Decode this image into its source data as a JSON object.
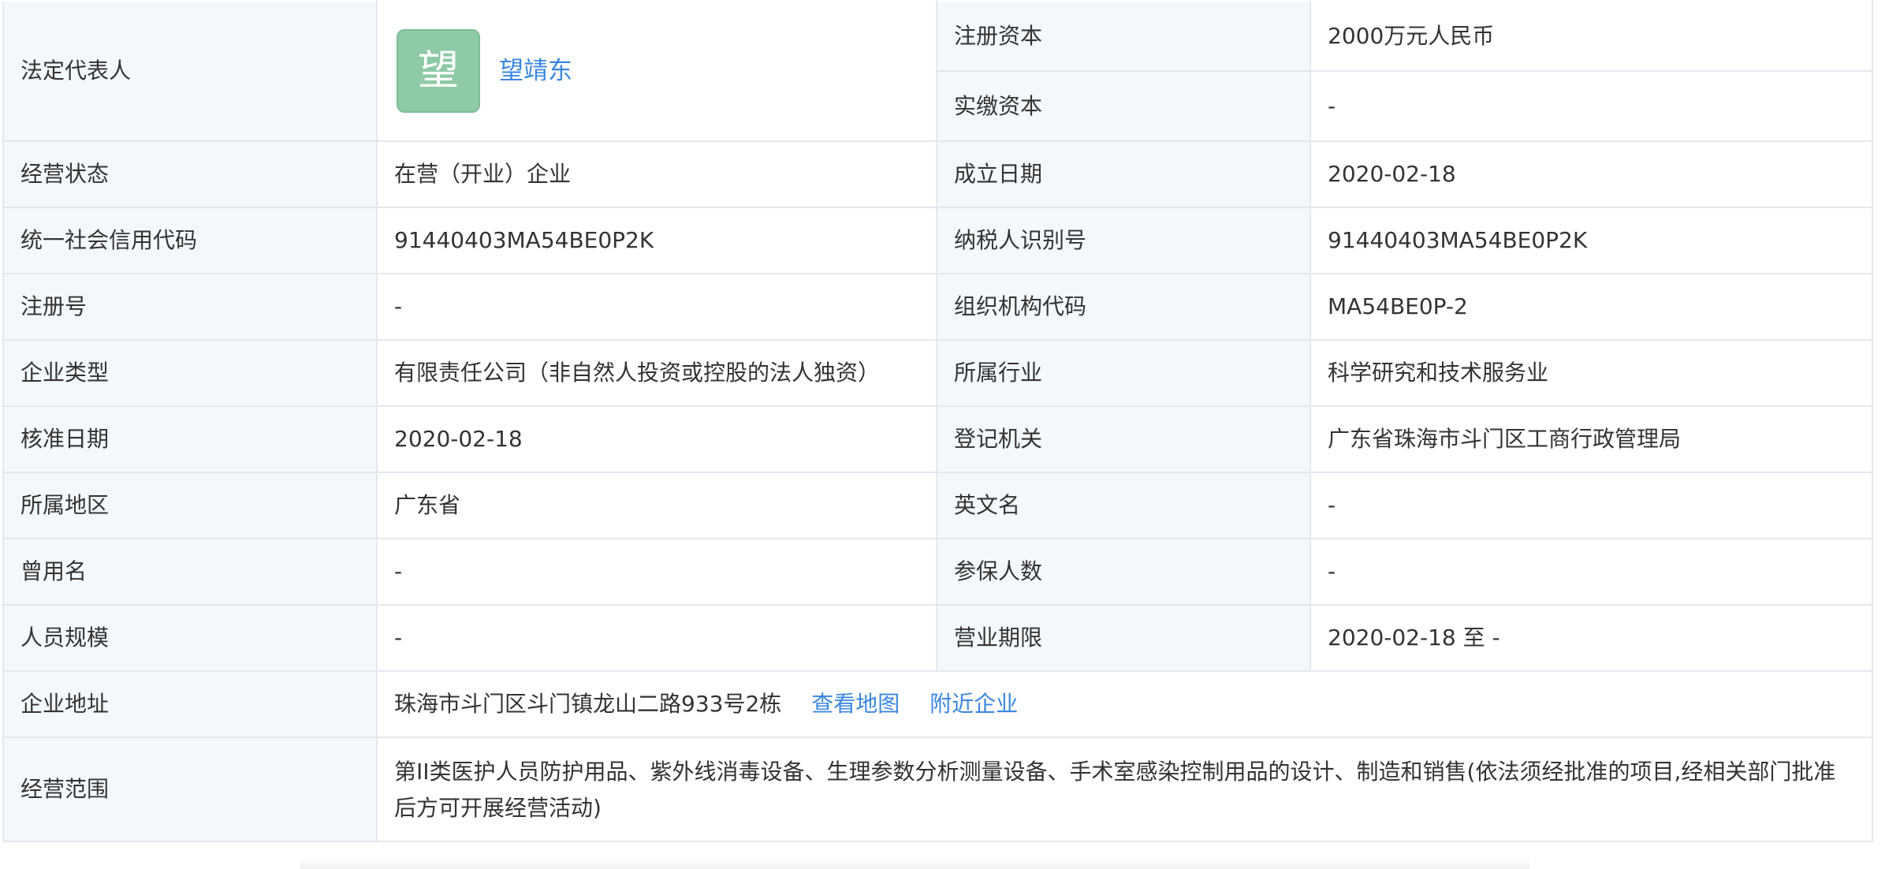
{
  "rows": [
    {
      "l1": "法定代表人",
      "l2": "注册资本",
      "v2": "2000万元人民币"
    },
    {
      "l2": "实缴资本",
      "v2": "-"
    },
    {
      "l1": "经营状态",
      "v1": "在营（开业）企业",
      "l2": "成立日期",
      "v2": "2020-02-18"
    },
    {
      "l1": "统一社会信用代码",
      "v1": "91440403MA54BE0P2K",
      "l2": "纳税人识别号",
      "v2": "91440403MA54BE0P2K"
    },
    {
      "l1": "注册号",
      "v1": "-",
      "l2": "组织机构代码",
      "v2": "MA54BE0P-2"
    },
    {
      "l1": "企业类型",
      "v1": "有限责任公司（非自然人投资或控股的法人独资）",
      "l2": "所属行业",
      "v2": "科学研究和技术服务业"
    },
    {
      "l1": "核准日期",
      "v1": "2020-02-18",
      "l2": "登记机关",
      "v2": "广东省珠海市斗门区工商行政管理局"
    },
    {
      "l1": "所属地区",
      "v1": "广东省",
      "l2": "英文名",
      "v2": "-"
    },
    {
      "l1": "曾用名",
      "v1": "-",
      "l2": "参保人数",
      "v2": "-"
    },
    {
      "l1": "人员规模",
      "v1": "-",
      "l2": "营业期限",
      "v2": "2020-02-18 至 -"
    }
  ],
  "legal_rep": {
    "avatar_char": "望",
    "name": "望靖东",
    "avatar_color": "#8ecaa5"
  },
  "address": {
    "label": "企业地址",
    "value": "珠海市斗门区斗门镇龙山二路933号2栋",
    "map_link": "查看地图",
    "nearby_link": "附近企业"
  },
  "scope": {
    "label": "经营范围",
    "value": "第II类医护人员防护用品、紫外线消毒设备、生理参数分析测量设备、手术室感染控制用品的设计、制造和销售(依法须经批准的项目,经相关部门批准后方可开展经营活动)"
  },
  "colors": {
    "label_bg": "#f3f8fd",
    "border": "#e4e8ee",
    "link": "#3a87e0",
    "text": "#333333"
  }
}
